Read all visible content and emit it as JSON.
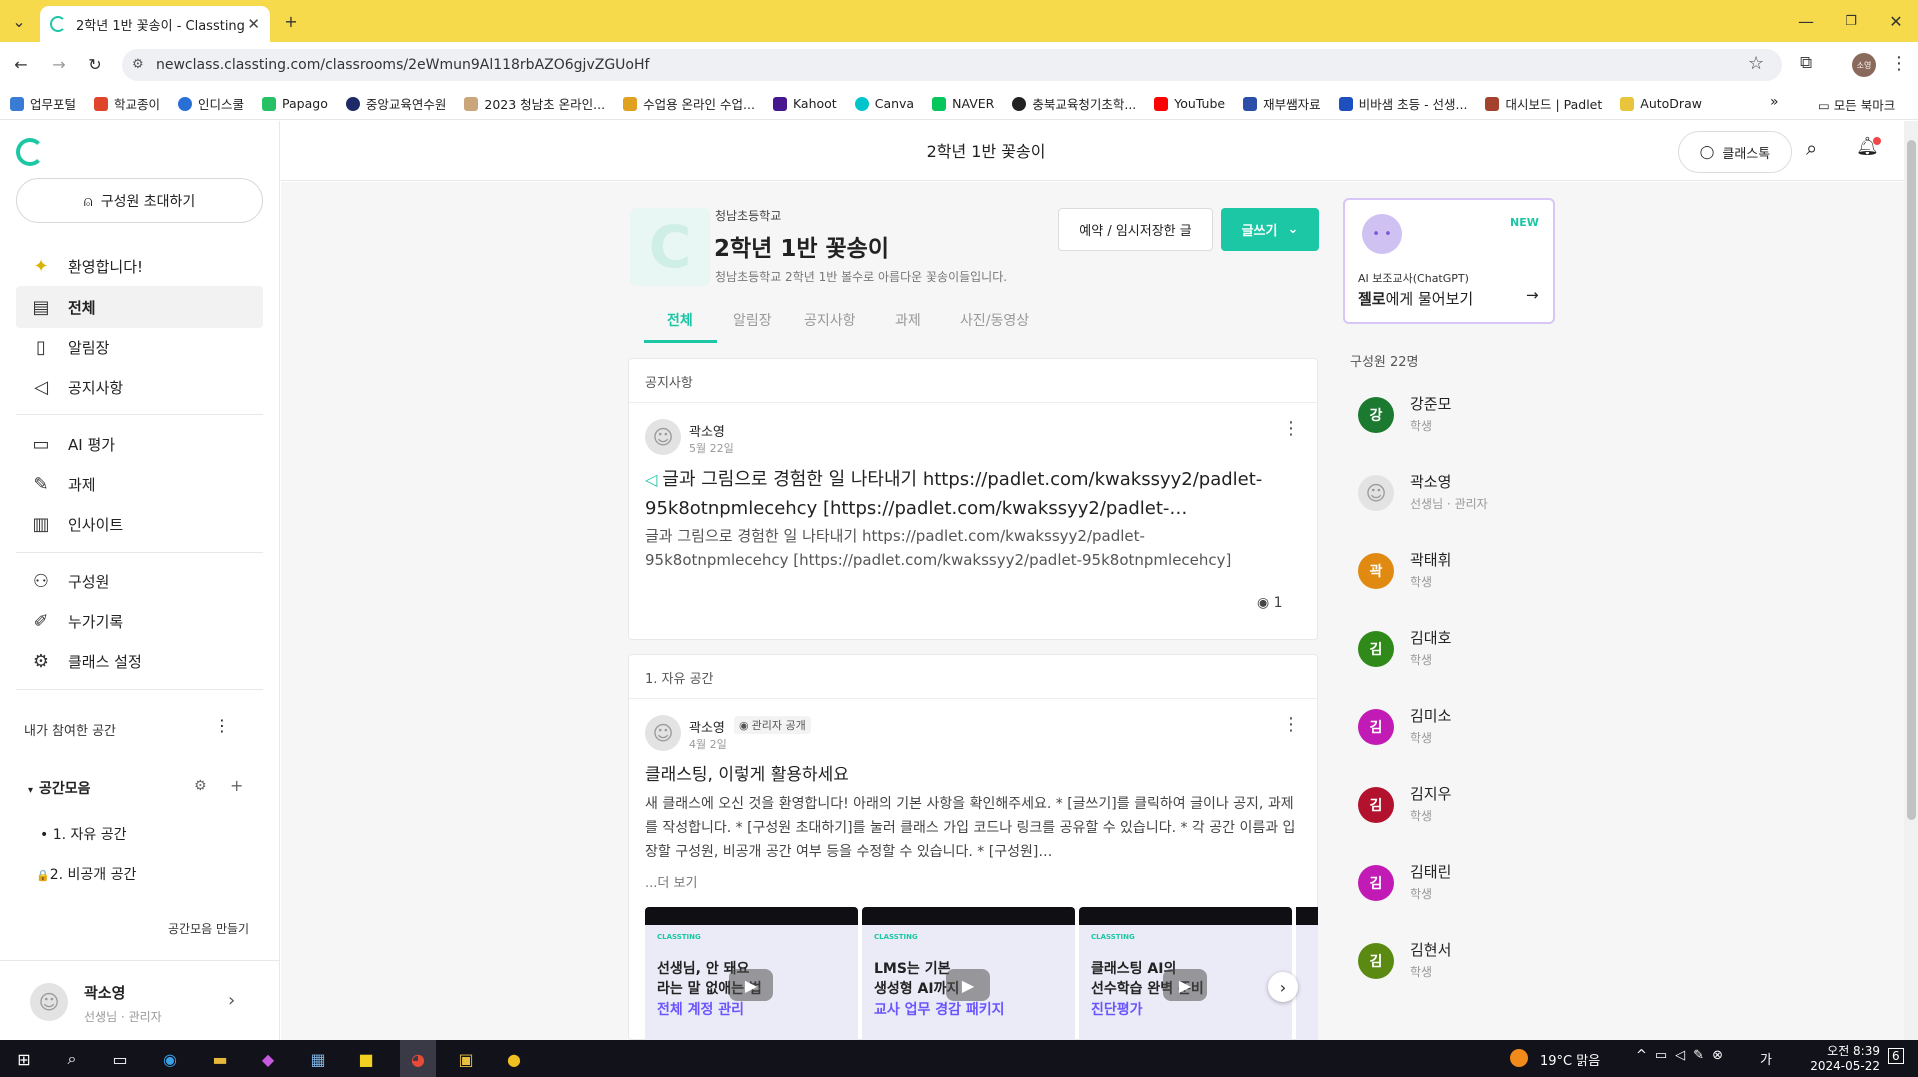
{
  "browser": {
    "tab_title": "2학년 1반 꽃송이 - Classting",
    "url": "newclass.classting.com/classrooms/2eWmun9Al118rbAZO6gjvZGUoHf",
    "bookmarks": [
      "업무포털",
      "학교종이",
      "인디스쿨",
      "Papago",
      "중앙교육연수원",
      "2023 청남초 온라인...",
      "수업용 온라인 수업...",
      "Kahoot",
      "Canva",
      "NAVER",
      "충북교육청기초학...",
      "YouTube",
      "재부쌤자료",
      "비바샘 초등 - 선생...",
      "대시보드 | Padlet",
      "AutoDraw"
    ],
    "all_bookmarks": "모든 북마크",
    "profile_initials": "소영"
  },
  "sidebar": {
    "invite_label": "구성원 초대하기",
    "nav": [
      {
        "label": "환영합니다!",
        "icon": "sparkle-icon"
      },
      {
        "label": "전체",
        "icon": "list-icon"
      },
      {
        "label": "알림장",
        "icon": "notebook-icon"
      },
      {
        "label": "공지사항",
        "icon": "megaphone-icon"
      },
      {
        "label": "AI 평가",
        "icon": "ai-eval-icon"
      },
      {
        "label": "과제",
        "icon": "pencil-icon"
      },
      {
        "label": "인사이트",
        "icon": "chart-icon"
      },
      {
        "label": "구성원",
        "icon": "people-icon"
      },
      {
        "label": "누가기록",
        "icon": "record-icon"
      },
      {
        "label": "클래스 설정",
        "icon": "gear-icon"
      }
    ],
    "my_spaces": "내가 참여한 공간",
    "space_group": "공간모음",
    "spaces": [
      "1. 자유 공간",
      "2. 비공개 공간"
    ],
    "make_group": "공간모음 만들기",
    "user_name": "곽소영",
    "user_role": "선생님 · 관리자"
  },
  "header": {
    "title": "2학년 1반 꽃송이",
    "chat_label": "클래스톡"
  },
  "class": {
    "school": "청남초등학교",
    "name": "2학년 1반 꽃송이",
    "description": "청남초등학교 2학년 1반 볼수로 아름다운 꽃송이들입니다.",
    "reserve_btn": "예약 / 임시저장한 글",
    "write_btn": "글쓰기",
    "tabs": [
      "전체",
      "알림장",
      "공지사항",
      "과제",
      "사진/동영상"
    ]
  },
  "notice": {
    "section": "공지사항",
    "author": "곽소영",
    "date": "5월 22일",
    "title": "글과 그림으로 경험한 일 나타내기 https://padlet.com/kwakssyy2/padlet-95k8otnpmlecehcy [https://padlet.com/kwakssyy2/padlet-…",
    "body": "글과 그림으로 경험한 일 나타내기 https://padlet.com/kwakssyy2/padlet-95k8otnpmlecehcy [https://padlet.com/kwakssyy2/padlet-95k8otnpmlecehcy]",
    "views": "1"
  },
  "free_post": {
    "section": "1. 자유 공간",
    "author": "곽소영",
    "badge": "관리자 공개",
    "date": "4월 2일",
    "title": "클래스팅, 이렇게 활용하세요",
    "body": "새 클래스에 오신 것을 환영합니다! 아래의 기본 사항을 확인해주세요. * [글쓰기]를 클릭하여 글이나 공지, 과제를 작성합니다. * [구성원 초대하기]를 눌러 클래스 가입 코드나 링크를 공유할 수 있습니다. * 각 공간 이름과 입장할 구성원, 비공개 공간 여부 등을 수정할 수 있습니다. * [구성원]…",
    "more": "...더 보기",
    "thumbs": [
      {
        "brand": "CLASSTING",
        "line1": "선생님, 안 돼요",
        "line2": "라는 말 없애는 법",
        "accent": "전체 계정 관리"
      },
      {
        "brand": "CLASSTING",
        "line1": "LMS는 기본",
        "line2": "생성형 AI까지",
        "accent": "교사 업무 경감 패키지"
      },
      {
        "brand": "CLASSTING",
        "line1": "클래스팅 AI의",
        "line2": "선수학습 완벽 준비",
        "accent": "진단평가"
      }
    ]
  },
  "ai_box": {
    "badge": "NEW",
    "sub": "AI 보조교사(ChatGPT)",
    "title_bold": "젤로",
    "title_rest": "에게 물어보기"
  },
  "members": {
    "header": "구성원 22명",
    "list": [
      {
        "initial": "강",
        "name": "강준모",
        "role": "학생",
        "color": "#1b7a2f"
      },
      {
        "initial": "",
        "name": "곽소영",
        "role": "선생님 · 관리자",
        "color": "#e3e3e3"
      },
      {
        "initial": "곽",
        "name": "곽태휘",
        "role": "학생",
        "color": "#e08a12"
      },
      {
        "initial": "김",
        "name": "김대호",
        "role": "학생",
        "color": "#2f8a1a"
      },
      {
        "initial": "김",
        "name": "김미소",
        "role": "학생",
        "color": "#c21bb5"
      },
      {
        "initial": "김",
        "name": "김지우",
        "role": "학생",
        "color": "#b3122e"
      },
      {
        "initial": "김",
        "name": "김태린",
        "role": "학생",
        "color": "#c21bb5"
      },
      {
        "initial": "김",
        "name": "김현서",
        "role": "학생",
        "color": "#5a8a12"
      }
    ]
  },
  "taskbar": {
    "weather": "19°C 맑음",
    "time": "오전 8:39",
    "date": "2024-05-22",
    "notif": "6"
  }
}
